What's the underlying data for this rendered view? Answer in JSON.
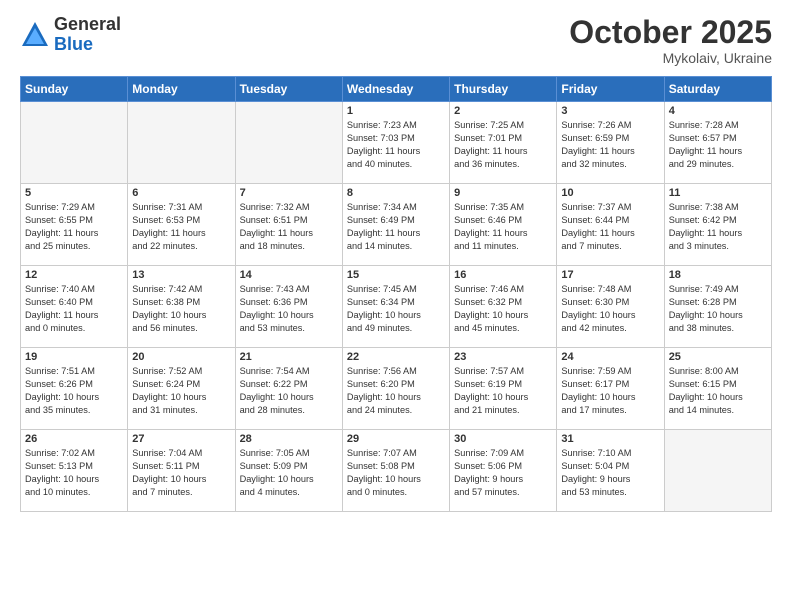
{
  "header": {
    "logo_general": "General",
    "logo_blue": "Blue",
    "month": "October 2025",
    "location": "Mykolaiv, Ukraine"
  },
  "days_of_week": [
    "Sunday",
    "Monday",
    "Tuesday",
    "Wednesday",
    "Thursday",
    "Friday",
    "Saturday"
  ],
  "weeks": [
    [
      {
        "day": "",
        "info": ""
      },
      {
        "day": "",
        "info": ""
      },
      {
        "day": "",
        "info": ""
      },
      {
        "day": "1",
        "info": "Sunrise: 7:23 AM\nSunset: 7:03 PM\nDaylight: 11 hours\nand 40 minutes."
      },
      {
        "day": "2",
        "info": "Sunrise: 7:25 AM\nSunset: 7:01 PM\nDaylight: 11 hours\nand 36 minutes."
      },
      {
        "day": "3",
        "info": "Sunrise: 7:26 AM\nSunset: 6:59 PM\nDaylight: 11 hours\nand 32 minutes."
      },
      {
        "day": "4",
        "info": "Sunrise: 7:28 AM\nSunset: 6:57 PM\nDaylight: 11 hours\nand 29 minutes."
      }
    ],
    [
      {
        "day": "5",
        "info": "Sunrise: 7:29 AM\nSunset: 6:55 PM\nDaylight: 11 hours\nand 25 minutes."
      },
      {
        "day": "6",
        "info": "Sunrise: 7:31 AM\nSunset: 6:53 PM\nDaylight: 11 hours\nand 22 minutes."
      },
      {
        "day": "7",
        "info": "Sunrise: 7:32 AM\nSunset: 6:51 PM\nDaylight: 11 hours\nand 18 minutes."
      },
      {
        "day": "8",
        "info": "Sunrise: 7:34 AM\nSunset: 6:49 PM\nDaylight: 11 hours\nand 14 minutes."
      },
      {
        "day": "9",
        "info": "Sunrise: 7:35 AM\nSunset: 6:46 PM\nDaylight: 11 hours\nand 11 minutes."
      },
      {
        "day": "10",
        "info": "Sunrise: 7:37 AM\nSunset: 6:44 PM\nDaylight: 11 hours\nand 7 minutes."
      },
      {
        "day": "11",
        "info": "Sunrise: 7:38 AM\nSunset: 6:42 PM\nDaylight: 11 hours\nand 3 minutes."
      }
    ],
    [
      {
        "day": "12",
        "info": "Sunrise: 7:40 AM\nSunset: 6:40 PM\nDaylight: 11 hours\nand 0 minutes."
      },
      {
        "day": "13",
        "info": "Sunrise: 7:42 AM\nSunset: 6:38 PM\nDaylight: 10 hours\nand 56 minutes."
      },
      {
        "day": "14",
        "info": "Sunrise: 7:43 AM\nSunset: 6:36 PM\nDaylight: 10 hours\nand 53 minutes."
      },
      {
        "day": "15",
        "info": "Sunrise: 7:45 AM\nSunset: 6:34 PM\nDaylight: 10 hours\nand 49 minutes."
      },
      {
        "day": "16",
        "info": "Sunrise: 7:46 AM\nSunset: 6:32 PM\nDaylight: 10 hours\nand 45 minutes."
      },
      {
        "day": "17",
        "info": "Sunrise: 7:48 AM\nSunset: 6:30 PM\nDaylight: 10 hours\nand 42 minutes."
      },
      {
        "day": "18",
        "info": "Sunrise: 7:49 AM\nSunset: 6:28 PM\nDaylight: 10 hours\nand 38 minutes."
      }
    ],
    [
      {
        "day": "19",
        "info": "Sunrise: 7:51 AM\nSunset: 6:26 PM\nDaylight: 10 hours\nand 35 minutes."
      },
      {
        "day": "20",
        "info": "Sunrise: 7:52 AM\nSunset: 6:24 PM\nDaylight: 10 hours\nand 31 minutes."
      },
      {
        "day": "21",
        "info": "Sunrise: 7:54 AM\nSunset: 6:22 PM\nDaylight: 10 hours\nand 28 minutes."
      },
      {
        "day": "22",
        "info": "Sunrise: 7:56 AM\nSunset: 6:20 PM\nDaylight: 10 hours\nand 24 minutes."
      },
      {
        "day": "23",
        "info": "Sunrise: 7:57 AM\nSunset: 6:19 PM\nDaylight: 10 hours\nand 21 minutes."
      },
      {
        "day": "24",
        "info": "Sunrise: 7:59 AM\nSunset: 6:17 PM\nDaylight: 10 hours\nand 17 minutes."
      },
      {
        "day": "25",
        "info": "Sunrise: 8:00 AM\nSunset: 6:15 PM\nDaylight: 10 hours\nand 14 minutes."
      }
    ],
    [
      {
        "day": "26",
        "info": "Sunrise: 7:02 AM\nSunset: 5:13 PM\nDaylight: 10 hours\nand 10 minutes."
      },
      {
        "day": "27",
        "info": "Sunrise: 7:04 AM\nSunset: 5:11 PM\nDaylight: 10 hours\nand 7 minutes."
      },
      {
        "day": "28",
        "info": "Sunrise: 7:05 AM\nSunset: 5:09 PM\nDaylight: 10 hours\nand 4 minutes."
      },
      {
        "day": "29",
        "info": "Sunrise: 7:07 AM\nSunset: 5:08 PM\nDaylight: 10 hours\nand 0 minutes."
      },
      {
        "day": "30",
        "info": "Sunrise: 7:09 AM\nSunset: 5:06 PM\nDaylight: 9 hours\nand 57 minutes."
      },
      {
        "day": "31",
        "info": "Sunrise: 7:10 AM\nSunset: 5:04 PM\nDaylight: 9 hours\nand 53 minutes."
      },
      {
        "day": "",
        "info": ""
      }
    ]
  ]
}
